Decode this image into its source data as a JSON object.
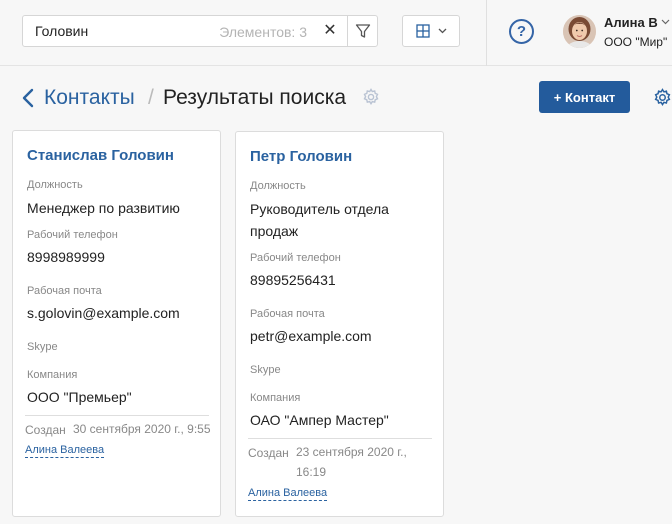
{
  "search": {
    "value": "Головин",
    "count_label": "Элементов: 3",
    "clear_glyph": "✕"
  },
  "user": {
    "name": "Алина В",
    "org": "ООО \"Мир\""
  },
  "help": {
    "glyph": "?"
  },
  "breadcrumb": {
    "parent": "Контакты",
    "separator": "/",
    "current": "Результаты поиска"
  },
  "toolbar": {
    "add_label": "+ Контакт"
  },
  "labels": {
    "position": "Должность",
    "work_phone": "Рабочий телефон",
    "work_email": "Рабочая почта",
    "skype": "Skype",
    "company": "Компания",
    "created": "Создан"
  },
  "contacts": [
    {
      "name": "Станислав Головин",
      "position": "Менеджер по развитию",
      "phone": "8998989999",
      "email": "s.golovin@example.com",
      "skype": "",
      "company": "ООО \"Премьер\"",
      "created": "30 сентября 2020 г., 9:55",
      "author": "Алина Валеева"
    },
    {
      "name": "Петр Головин",
      "position": "Руководитель отдела продаж",
      "phone": "89895256431",
      "email": "petr@example.com",
      "skype": "",
      "company": "ОАО \"Ампер Мастер\"",
      "created": "23 сентября 2020 г., 16:19",
      "author": "Алина Валеева"
    }
  ],
  "colors": {
    "accent": "#235b9c",
    "link": "#2a62a0",
    "background": "#f7f7f7"
  },
  "icons": [
    "filter-icon",
    "grid-view-icon",
    "chevron-down-icon",
    "help-icon",
    "back-arrow-icon",
    "gear-icon",
    "avatar"
  ]
}
